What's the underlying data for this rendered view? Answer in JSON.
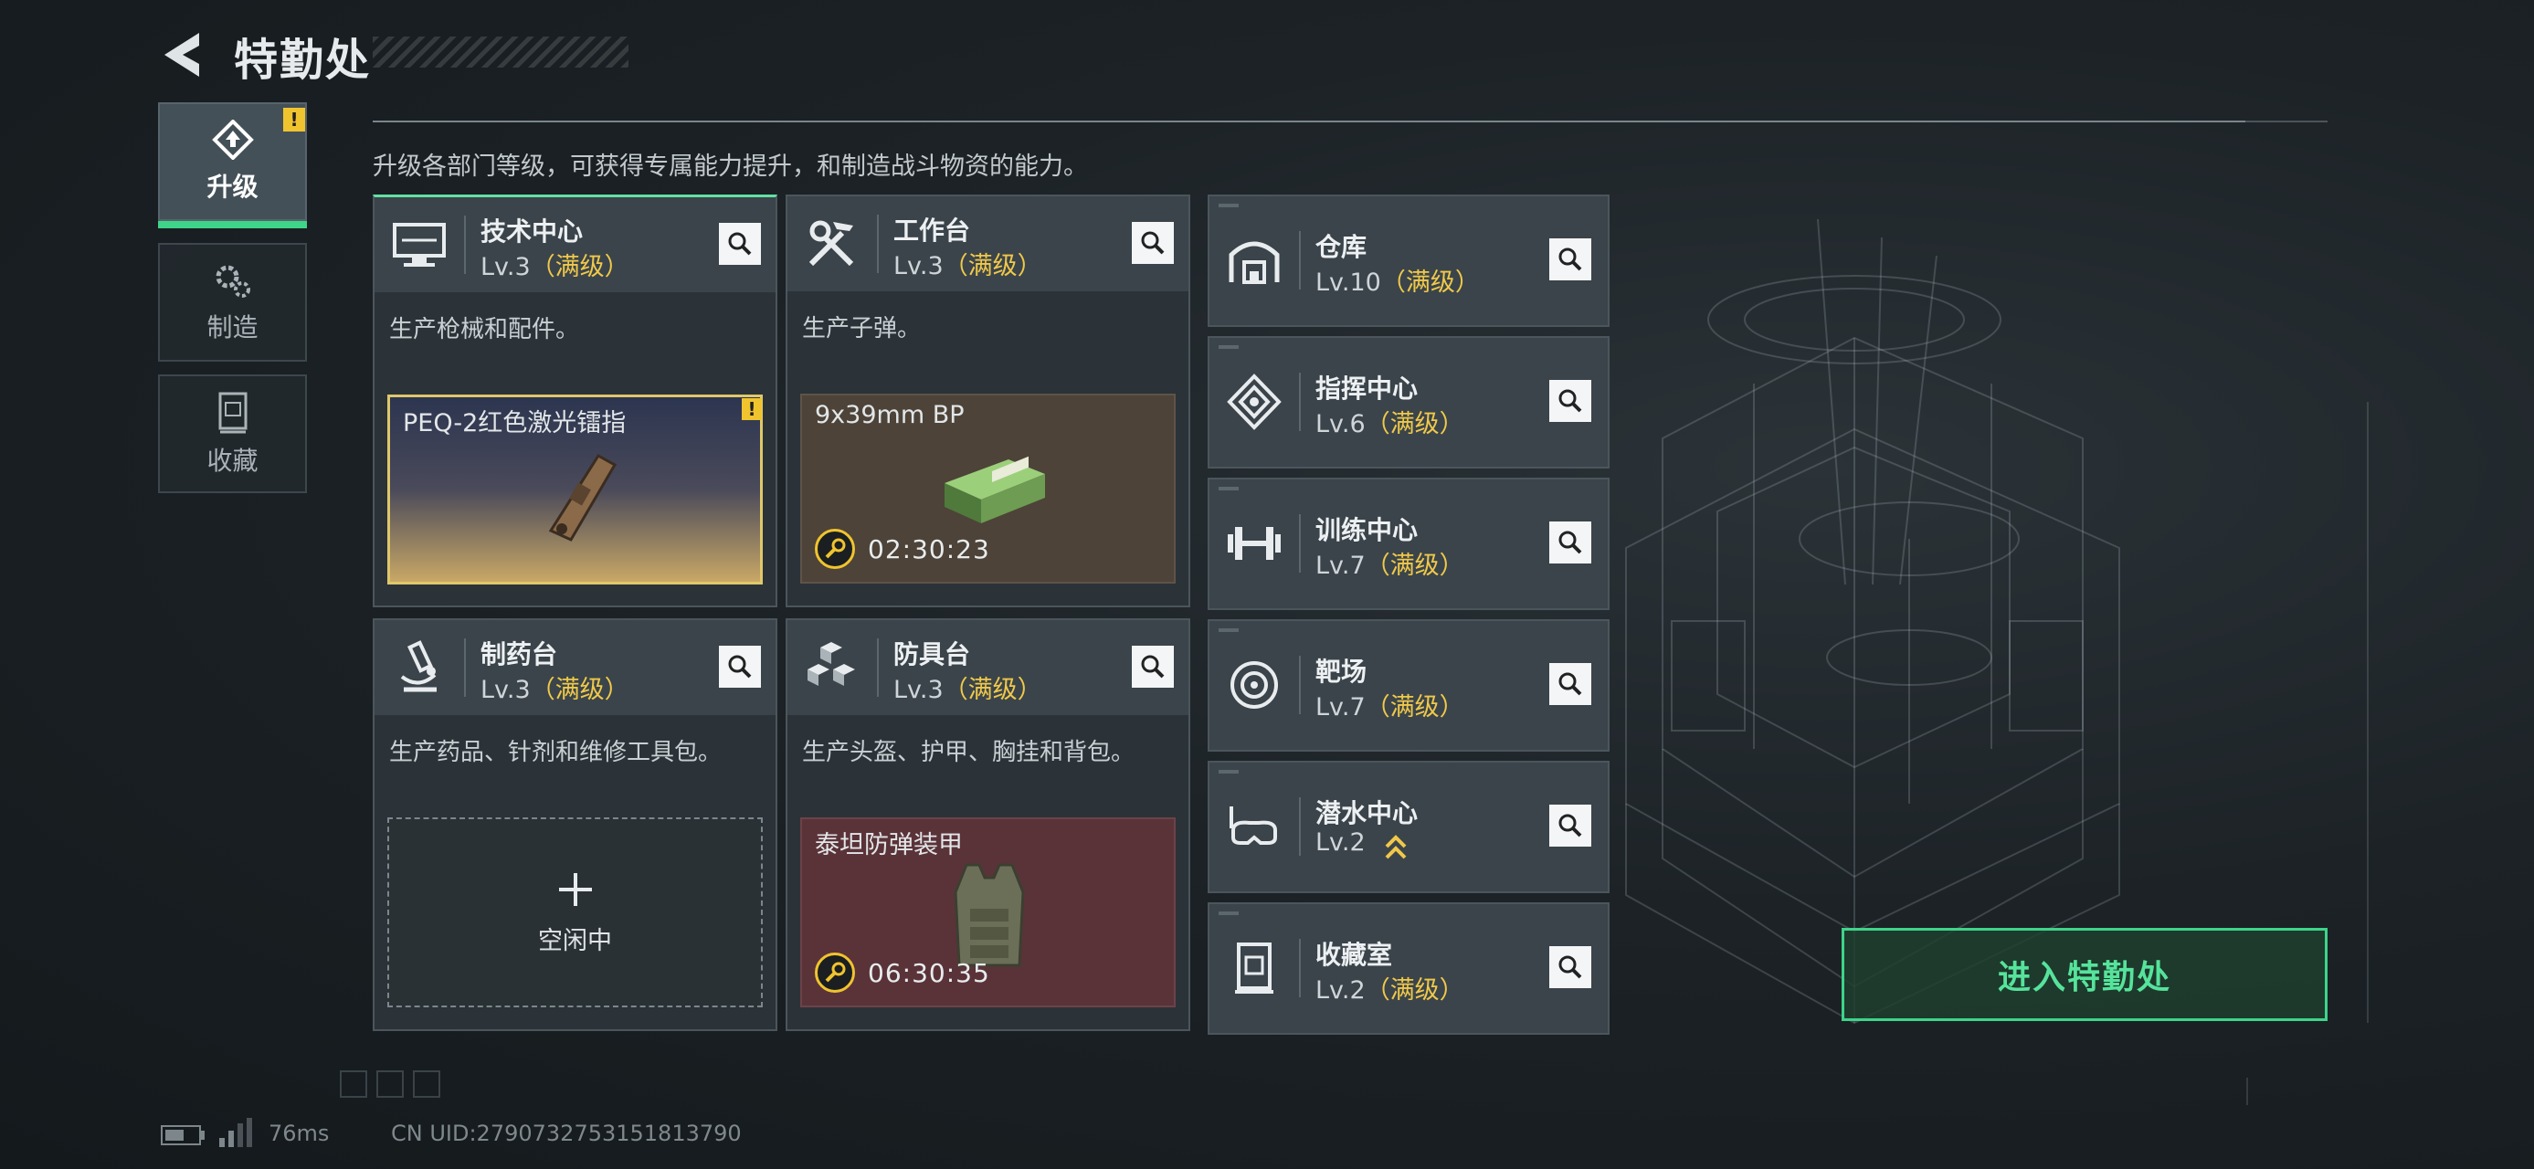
{
  "header": {
    "title": "特勤处"
  },
  "sidebar": {
    "tabs": [
      {
        "label": "升级",
        "icon": "upgrade-icon",
        "active": true,
        "warning": "!"
      },
      {
        "label": "制造",
        "icon": "gears-icon",
        "active": false
      },
      {
        "label": "收藏",
        "icon": "collection-icon",
        "active": false
      }
    ]
  },
  "description": "升级各部门等级，可获得专属能力提升，和制造战斗物资的能力。",
  "departments": [
    {
      "name": "技术中心",
      "level": "Lv.3",
      "status": "（满级）",
      "icon": "monitor-icon",
      "desc": "生产枪械和配件。",
      "slot": {
        "item": "PEQ-2红色激光镭指",
        "warning": "!"
      }
    },
    {
      "name": "工作台",
      "level": "Lv.3",
      "status": "（满级）",
      "icon": "tools-icon",
      "desc": "生产子弹。",
      "slot": {
        "item": "9x39mm BP",
        "timer": "02:30:23"
      }
    },
    {
      "name": "制药台",
      "level": "Lv.3",
      "status": "（满级）",
      "icon": "microscope-icon",
      "desc": "生产药品、针剂和维修工具包。",
      "slot": {
        "idle_label": "空闲中"
      }
    },
    {
      "name": "防具台",
      "level": "Lv.3",
      "status": "（满级）",
      "icon": "armor-blocks-icon",
      "desc": "生产头盔、护甲、胸挂和背包。",
      "slot": {
        "item": "泰坦防弹装甲",
        "timer": "06:30:35"
      }
    }
  ],
  "facilities": [
    {
      "name": "仓库",
      "level": "Lv.10",
      "status": "（满级）",
      "icon": "warehouse-icon"
    },
    {
      "name": "指挥中心",
      "level": "Lv.6",
      "status": "（满级）",
      "icon": "command-icon"
    },
    {
      "name": "训练中心",
      "level": "Lv.7",
      "status": "（满级）",
      "icon": "dumbbell-icon"
    },
    {
      "name": "靶场",
      "level": "Lv.7",
      "status": "（满级）",
      "icon": "target-icon"
    },
    {
      "name": "潜水中心",
      "level": "Lv.2",
      "status": "",
      "icon": "diving-mask-icon",
      "upgrade_available": true
    },
    {
      "name": "收藏室",
      "level": "Lv.2",
      "status": "（满级）",
      "icon": "collection-room-icon"
    }
  ],
  "enter_button": "进入特勤处",
  "status_bar": {
    "ping": "76ms",
    "uid": "CN UID:2790732753151813790"
  },
  "colors": {
    "accent_green": "#3ed48a",
    "max_level_gold": "#f0c84a",
    "warning_yellow": "#f0c42e"
  }
}
